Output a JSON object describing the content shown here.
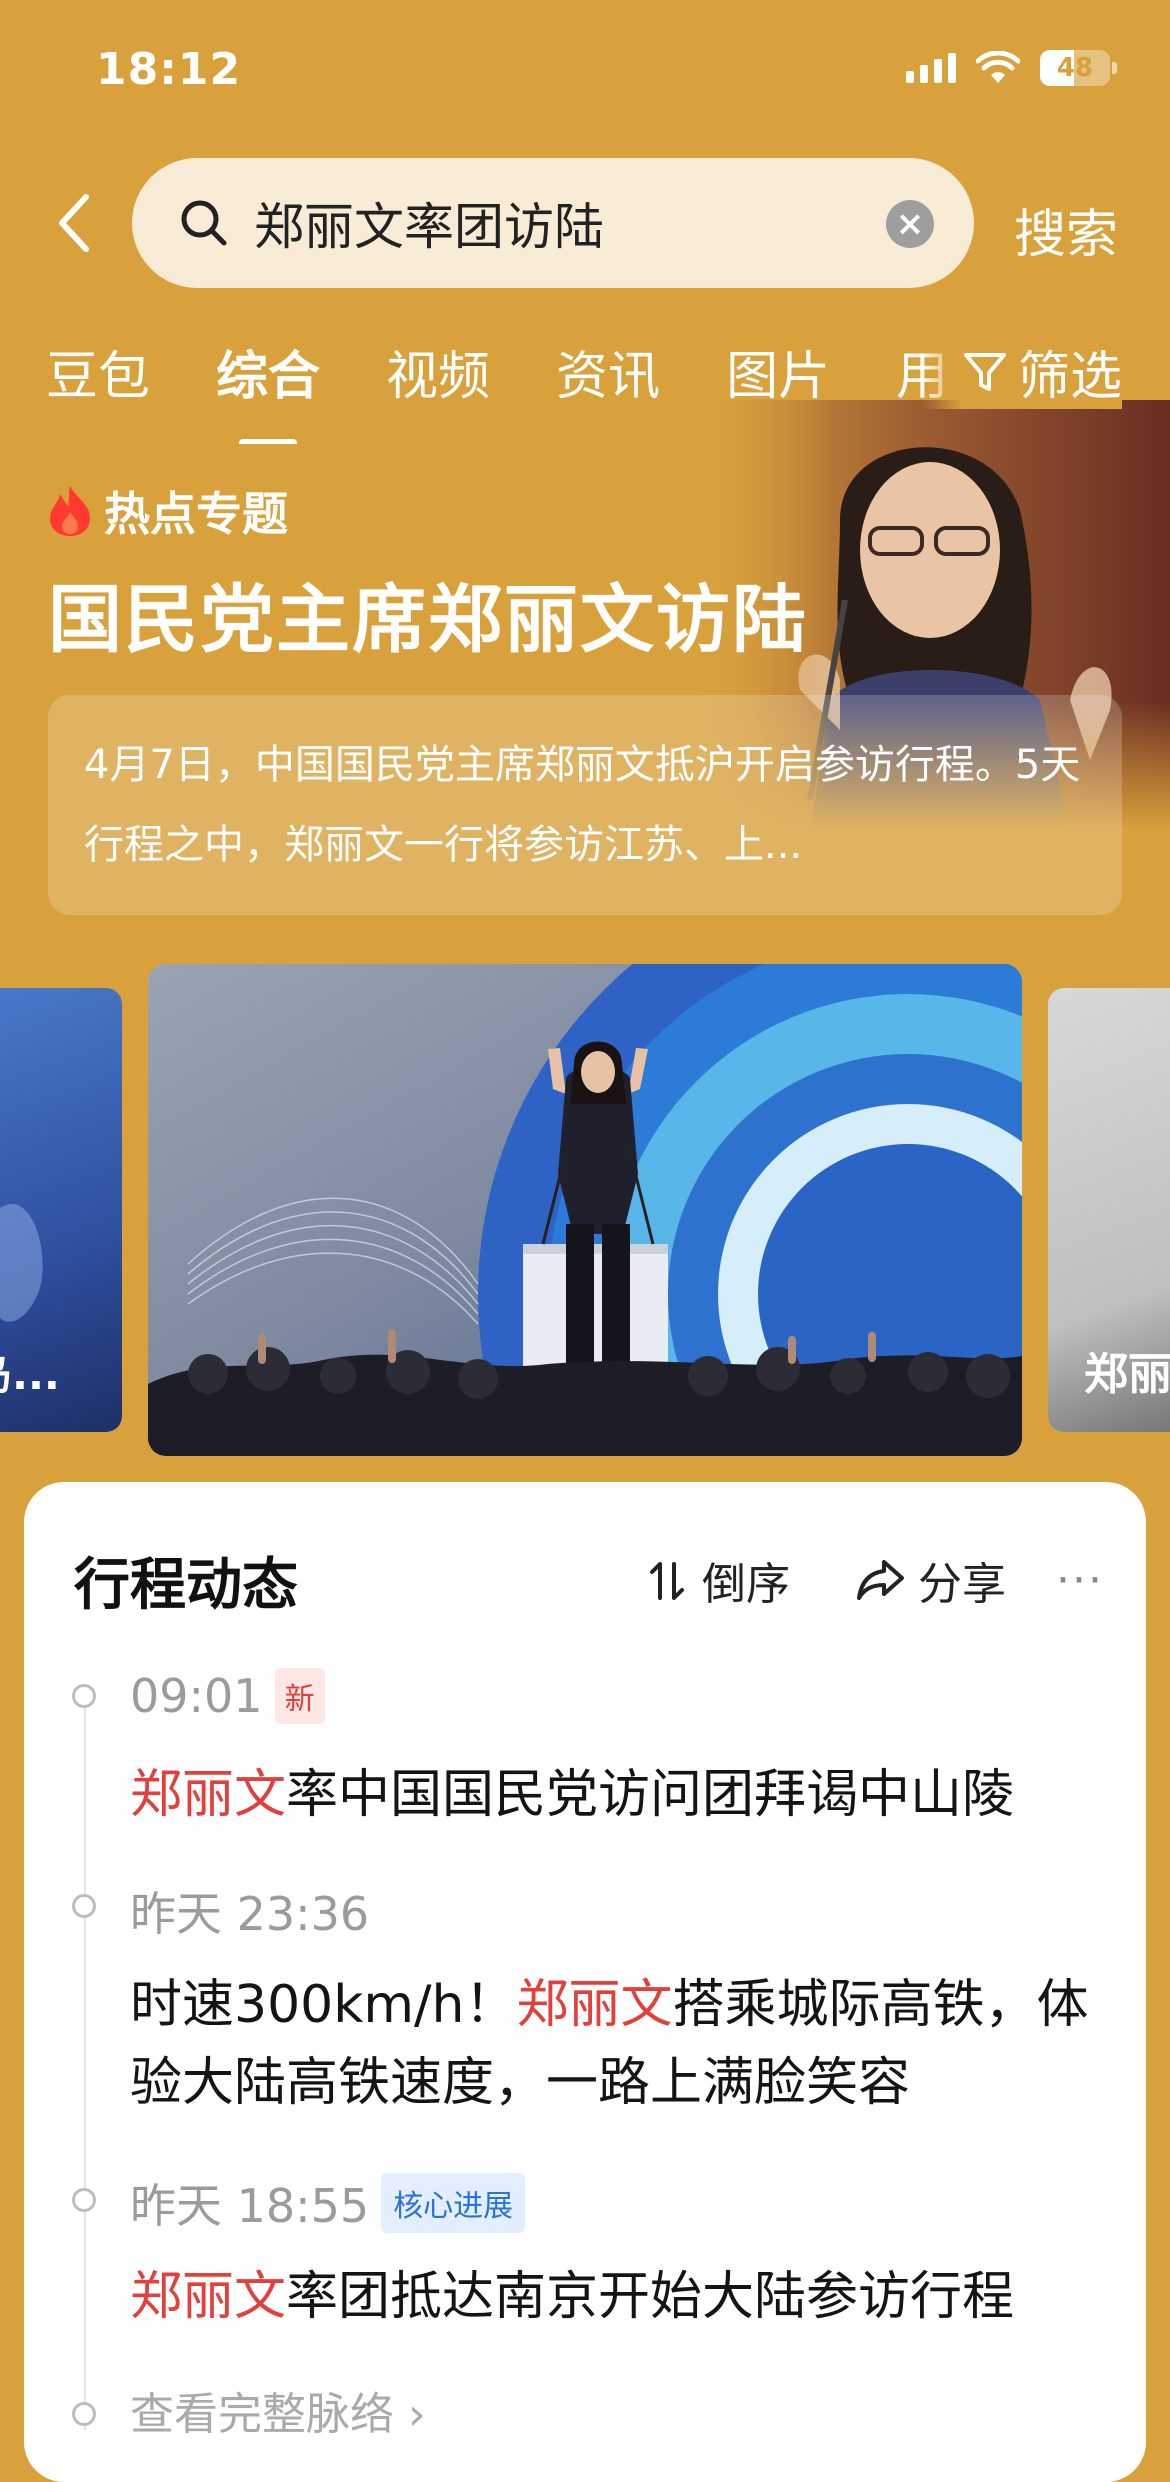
{
  "status_bar": {
    "time": "18:12",
    "battery": "48"
  },
  "search": {
    "query": "郑丽文率团访陆",
    "submit_label": "搜索"
  },
  "tabs": [
    "豆包",
    "综合",
    "视频",
    "资讯",
    "图片",
    "用户"
  ],
  "active_tab": "综合",
  "filter_label": "筛选",
  "topic": {
    "tag": "热点专题",
    "title": "国民党主席郑丽文访陆",
    "summary": "4月7日，中国国民党主席郑丽文抵沪开启参访行程。5天行程之中，郑丽文一行将参访江苏、上..."
  },
  "carousel": {
    "left_caption": "岛...",
    "right_caption": "郑丽"
  },
  "timeline": {
    "title": "行程动态",
    "sort_label": "倒序",
    "share_label": "分享",
    "more_label": "···",
    "items": [
      {
        "time": "09:01",
        "badge": "新",
        "highlight": "郑丽文",
        "text": "率中国国民党访问团拜谒中山陵"
      },
      {
        "time": "昨天 23:36",
        "badge": "",
        "pre": "时速300km/h！",
        "highlight": "郑丽文",
        "text": "搭乘城际高铁，体验大陆高铁速度，一路上满脸笑容"
      },
      {
        "time": "昨天 18:55",
        "badge": "核心进展",
        "highlight": "郑丽文",
        "text": "率团抵达南京开始大陆参访行程"
      }
    ],
    "view_full": "查看完整脉络"
  },
  "colors": {
    "background": "#d9a13c",
    "highlight": "#e2403c",
    "badge_blue": "#2b73d9"
  }
}
